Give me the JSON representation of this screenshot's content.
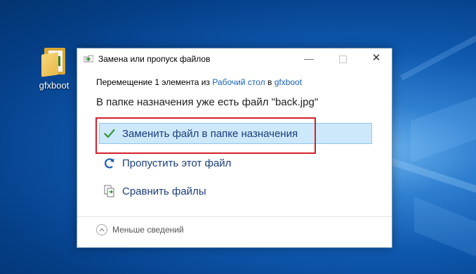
{
  "desktop": {
    "icon_label": "gfxboot"
  },
  "dialog": {
    "title": "Замена или пропуск файлов",
    "subtitle": {
      "prefix": "Перемещение 1 элемента из ",
      "source": "Рабочий стол",
      "middle": " в ",
      "destination": "gfxboot"
    },
    "heading": "В папке назначения уже есть файл \"back.jpg\"",
    "options": [
      {
        "label": "Заменить файл в папке назначения",
        "icon": "check-icon",
        "selected": true
      },
      {
        "label": "Пропустить этот файл",
        "icon": "skip-arrow-icon"
      },
      {
        "label": "Сравнить файлы",
        "icon": "compare-files-icon"
      }
    ],
    "details_toggle": "Меньше сведений"
  },
  "colors": {
    "accent_link": "#1a62b7",
    "selection_bg": "#cde8fb",
    "highlight_border": "#d3202a",
    "check_green": "#3c9c3c"
  }
}
